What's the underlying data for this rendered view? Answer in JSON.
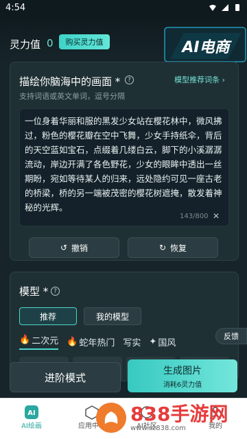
{
  "status": {
    "time": "4:54"
  },
  "header": {
    "ling_label": "灵力值",
    "ling_value": "0",
    "buy_label": "购买灵力值",
    "logo_text": "AI电商"
  },
  "prompt_card": {
    "title": "描绘你脑海中的画面",
    "required": "*",
    "help_icon": "question-icon",
    "recommend_link": "模型推荐词条",
    "hint": "支持词语或英文单词，逗号分隔",
    "text": "一位身着华丽和服的黑发少女站在樱花林中，微风拂过，粉色的樱花瓣在空中飞舞，少女手持纸伞，背后的天空蓝如宝石，点缀着几缕白云，脚下的小溪潺潺流动，岸边开满了各色野花，少女的眼眸中透出一丝期盼，宛如等待某人的归来，远处隐约可见一座古老的桥梁，桥的另一端被茂密的樱花树遮掩，散发着神秘的光辉。",
    "char_count": "143/800",
    "clear_icon": "close-icon",
    "undo_label": "撤销",
    "redo_label": "恢复"
  },
  "model_card": {
    "title": "模型",
    "required": "*",
    "tabs": [
      {
        "label": "推荐",
        "active": true
      },
      {
        "label": "我的模型",
        "active": false
      }
    ],
    "styles": [
      {
        "label": "二次元",
        "icon": "fire-icon",
        "active": true
      },
      {
        "label": "蛇年热门",
        "icon": "fire-icon",
        "active": false
      },
      {
        "label": "写实",
        "icon": "",
        "active": false
      },
      {
        "label": "国风",
        "icon": "sparkle-icon",
        "active": false
      }
    ],
    "feedback_label": "反馈"
  },
  "actions": {
    "advanced_label": "进阶模式",
    "generate_label": "生成图片",
    "generate_sub": "消耗6灵力值"
  },
  "bottom_nav": [
    {
      "label": "AI绘画",
      "icon": "ai-icon",
      "active": true
    },
    {
      "label": "应用中心",
      "icon": "cube-icon",
      "active": false
    },
    {
      "label": "AI社区",
      "icon": "community-icon",
      "active": false
    },
    {
      "label": "我的",
      "icon": "user-icon",
      "active": false
    }
  ],
  "watermark": {
    "title": "838手游网",
    "url": "www.sz838.com"
  },
  "colors": {
    "accent": "#4fd8ca",
    "background": "#17252a",
    "card": "#1f3035"
  }
}
